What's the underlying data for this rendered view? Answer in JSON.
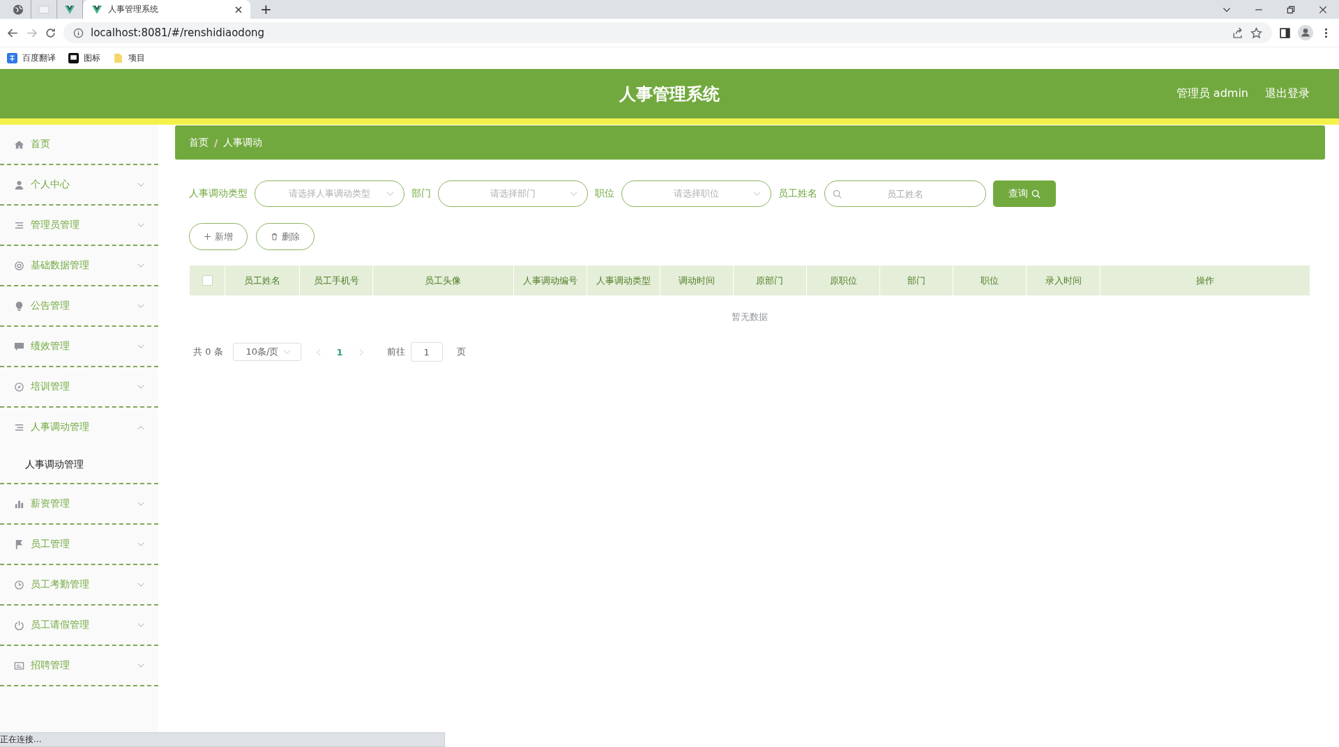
{
  "browser": {
    "tabs": [
      {
        "selected": false
      },
      {
        "selected": false
      },
      {
        "selected": false
      },
      {
        "title": "人事管理系统",
        "selected": true
      }
    ],
    "new_tab": "+",
    "address": "localhost:8081/#/renshidiaodong",
    "bookmarks": [
      "百度翻译",
      "图标",
      "项目"
    ]
  },
  "header": {
    "title": "人事管理系统",
    "user": "管理员 admin",
    "logout": "退出登录"
  },
  "sidebar": {
    "items": [
      {
        "label": "首页",
        "expandable": false
      },
      {
        "label": "个人中心",
        "expandable": true,
        "expanded": false
      },
      {
        "label": "管理员管理",
        "expandable": true,
        "expanded": false
      },
      {
        "label": "基础数据管理",
        "expandable": true,
        "expanded": false
      },
      {
        "label": "公告管理",
        "expandable": true,
        "expanded": false
      },
      {
        "label": "绩效管理",
        "expandable": true,
        "expanded": false
      },
      {
        "label": "培训管理",
        "expandable": true,
        "expanded": false
      },
      {
        "label": "人事调动管理",
        "expandable": true,
        "expanded": true,
        "children": [
          {
            "label": "人事调动管理"
          }
        ]
      },
      {
        "label": "薪资管理",
        "expandable": true,
        "expanded": false
      },
      {
        "label": "员工管理",
        "expandable": true,
        "expanded": false
      },
      {
        "label": "员工考勤管理",
        "expandable": true,
        "expanded": false
      },
      {
        "label": "员工请假管理",
        "expandable": true,
        "expanded": false
      },
      {
        "label": "招聘管理",
        "expandable": true,
        "expanded": false
      }
    ]
  },
  "breadcrumb": {
    "items": [
      "首页",
      "人事调动"
    ],
    "separator": "/"
  },
  "filters": [
    {
      "kind": "select",
      "label": "人事调动类型",
      "placeholder": "请选择人事调动类型"
    },
    {
      "kind": "select",
      "label": "部门",
      "placeholder": "请选择部门"
    },
    {
      "kind": "select",
      "label": "职位",
      "placeholder": "请选择职位"
    },
    {
      "kind": "search",
      "label": "员工姓名",
      "placeholder": "员工姓名"
    }
  ],
  "search_button": "查询",
  "actions": [
    {
      "kind": "add",
      "label": "新增"
    },
    {
      "kind": "delete",
      "label": "删除"
    }
  ],
  "table": {
    "select_all": {
      "checked": false
    },
    "columns": [
      "员工姓名",
      "员工手机号",
      "员工头像",
      "人事调动编号",
      "人事调动类型",
      "调动时间",
      "原部门",
      "原职位",
      "部门",
      "职位",
      "录入时间",
      "操作"
    ],
    "empty_text": "暂无数据"
  },
  "pagination": {
    "total": "共 0 条",
    "page_size": "10条/页",
    "pages": [
      {
        "label": "1",
        "selected": true
      }
    ],
    "goto_label": "前往",
    "goto_value": "1",
    "goto_suffix": "页"
  },
  "status_bar": "正在连接..."
}
